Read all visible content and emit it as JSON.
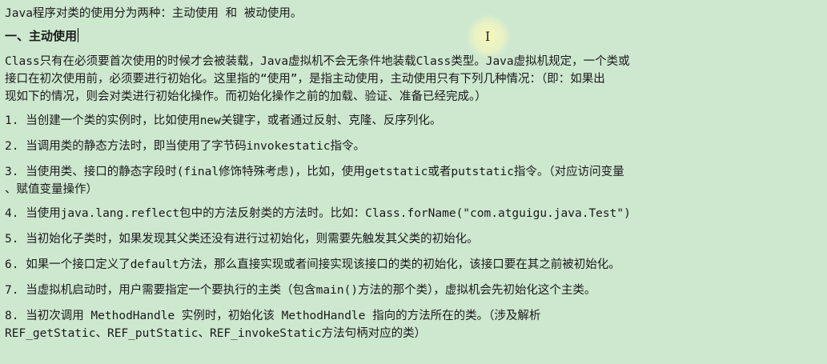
{
  "intro": "Java程序对类的使用分为两种：主动使用 和 被动使用。",
  "heading": "一、主动使用",
  "paragraph": [
    "Class只有在必须要首次使用的时候才会被装载，Java虚拟机不会无条件地装载Class类型。Java虚拟机规定，一个类或",
    "接口在初次使用前，必须要进行初始化。这里指的“使用”，是指主动使用，主动使用只有下列几种情况：（即：如果出",
    "现如下的情况，则会对类进行初始化操作。而初始化操作之前的加载、验证、准备已经完成。）"
  ],
  "items": [
    [
      "1. 当创建一个类的实例时，比如使用new关键字，或者通过反射、克隆、反序列化。"
    ],
    [
      "2. 当调用类的静态方法时，即当使用了字节码invokestatic指令。"
    ],
    [
      "3. 当使用类、接口的静态字段时(final修饰特殊考虑)，比如，使用getstatic或者putstatic指令。（对应访问变量",
      "、赋值变量操作）"
    ],
    [
      "4. 当使用java.lang.reflect包中的方法反射类的方法时。比如：Class.forName(\"com.atguigu.java.Test\")"
    ],
    [
      "5. 当初始化子类时，如果发现其父类还没有进行过初始化，则需要先触发其父类的初始化。"
    ],
    [
      "6. 如果一个接口定义了default方法，那么直接实现或者间接实现该接口的类的初始化，该接口要在其之前被初始化。"
    ],
    [
      "7. 当虚拟机启动时，用户需要指定一个要执行的主类（包含main()方法的那个类），虚拟机会先初始化这个主类。"
    ],
    [
      "8. 当初次调用 MethodHandle 实例时，初始化该 MethodHandle 指向的方法所在的类。（涉及解析",
      "REF_getStatic、REF_putStatic、REF_invokeStatic方法句柄对应的类）"
    ]
  ],
  "cursor": {
    "glyph": "I",
    "icon": "text-cursor-icon"
  }
}
